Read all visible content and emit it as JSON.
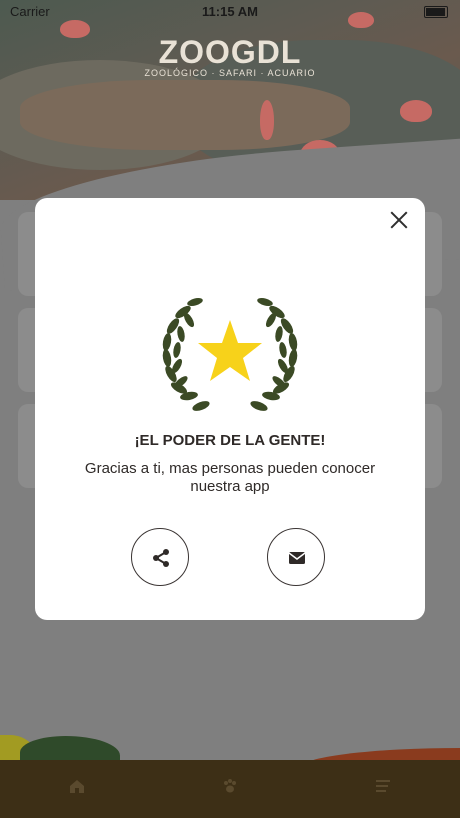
{
  "status_bar": {
    "carrier": "Carrier",
    "time": "11:15 AM"
  },
  "header": {
    "logo_title": "ZOOGDL",
    "logo_subtitle": "ZOOLÓGICO · SAFARI · ACUARIO"
  },
  "modal": {
    "title": "¡EL PODER DE LA GENTE!",
    "message": "Gracias a ti, mas personas pueden conocer nuestra app",
    "share_icon": "share-icon",
    "email_icon": "email-icon",
    "close_icon": "close-icon",
    "badge_icon": "laurel-star-icon"
  },
  "tab_bar": {
    "icons": [
      "home-icon",
      "paw-icon",
      "menu-icon"
    ]
  },
  "colors": {
    "star": "#f7d21a",
    "laurel": "#3b4a25",
    "footer": "#3d2f16",
    "overlay": "#7f7f7f"
  }
}
